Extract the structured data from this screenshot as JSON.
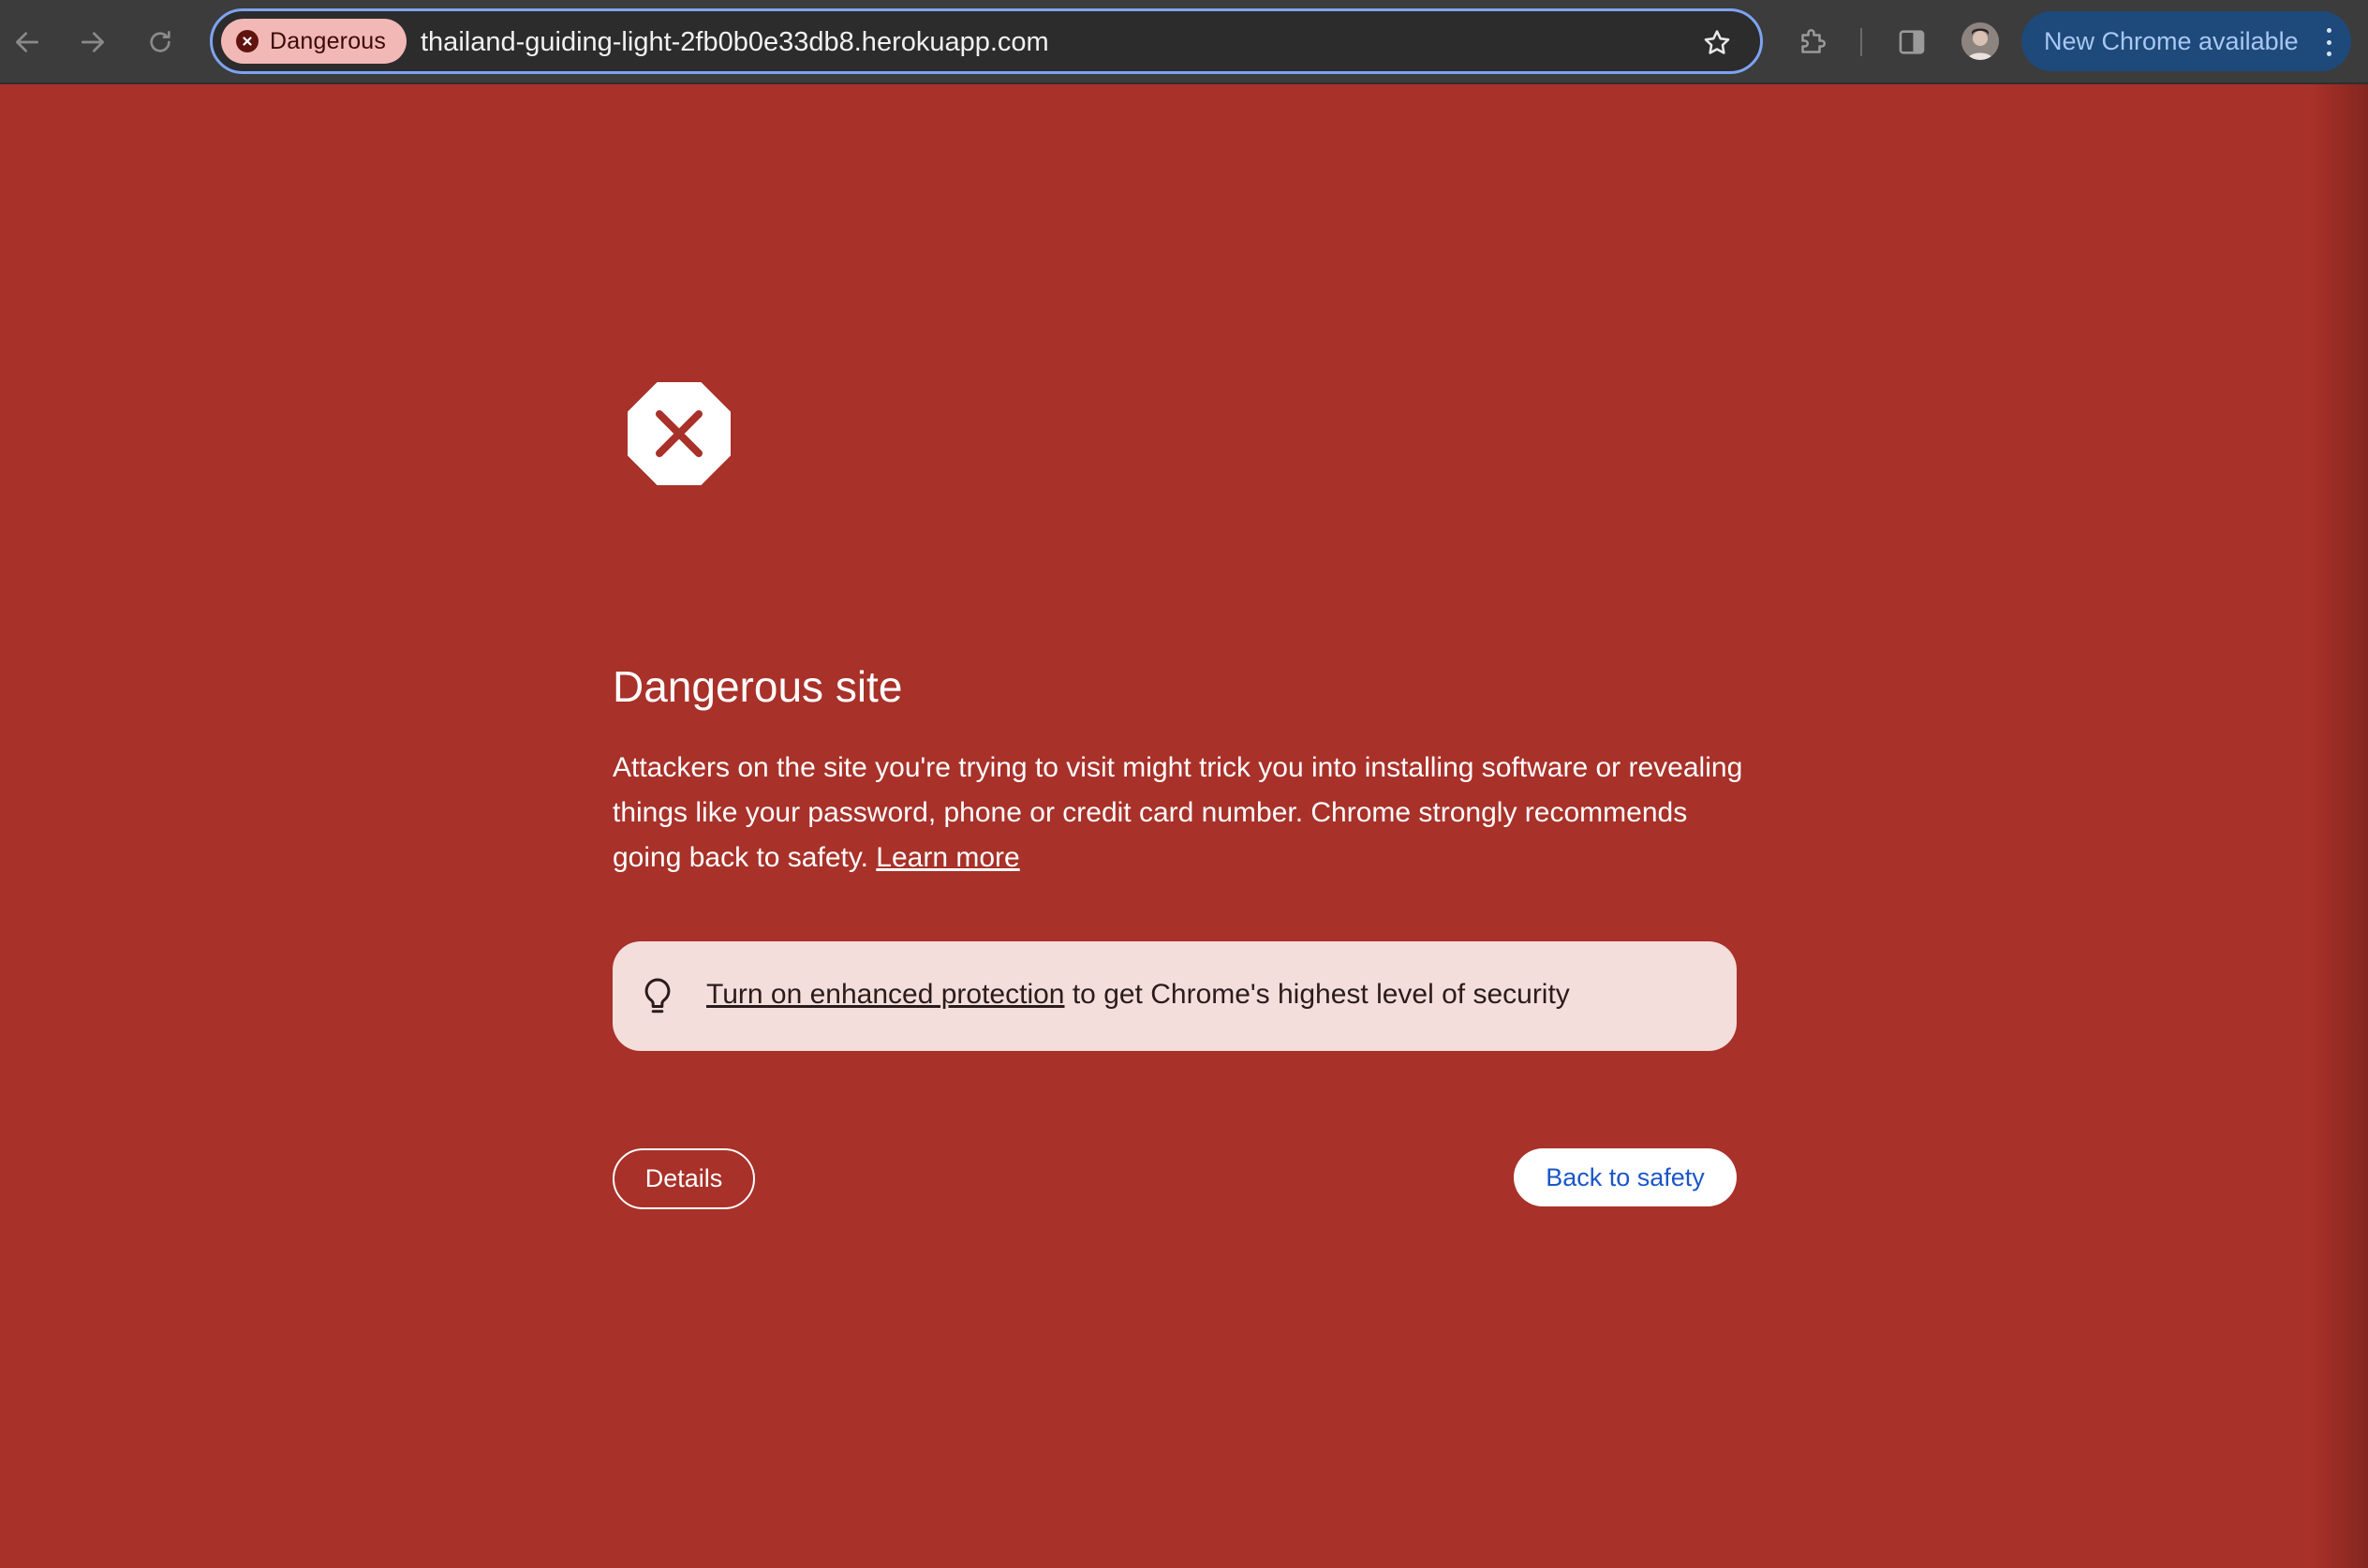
{
  "browser": {
    "nav": {
      "back_icon": "arrow-left-icon",
      "forward_icon": "arrow-right-icon",
      "reload_icon": "reload-icon"
    },
    "omnibox": {
      "security_chip_label": "Dangerous",
      "security_chip_icon": "danger-x-icon",
      "url": "thailand-guiding-light-2fb0b0e33db8.herokuapp.com",
      "bookmark_icon": "star-icon"
    },
    "toolbar_icons": [
      "extensions-puzzle-icon",
      "side-panel-icon",
      "profile-avatar"
    ],
    "update_pill": {
      "label": "New Chrome available",
      "menu_icon": "kebab-menu-icon"
    }
  },
  "interstitial": {
    "icon": "stop-octagon-x-icon",
    "title": "Dangerous site",
    "body": "Attackers on the site you're trying to visit might trick you into installing software or revealing things like your password, phone or credit card number. Chrome strongly recommends going back to safety.",
    "learn_more": "Learn more",
    "tip": {
      "icon": "lightbulb-icon",
      "link_text": "Turn on enhanced protection",
      "rest_text": " to get Chrome's highest level of security"
    },
    "details_button": "Details",
    "back_button": "Back to safety"
  },
  "colors": {
    "page_background": "#a83129",
    "toolbar_background": "#3c3c3c",
    "omnibox_focus_ring": "#7ea3f2",
    "danger_chip": "#f2b8b5",
    "tip_background": "#f4dedb",
    "update_pill": "#1d4a7a",
    "primary_button_text": "#1a56c8"
  }
}
